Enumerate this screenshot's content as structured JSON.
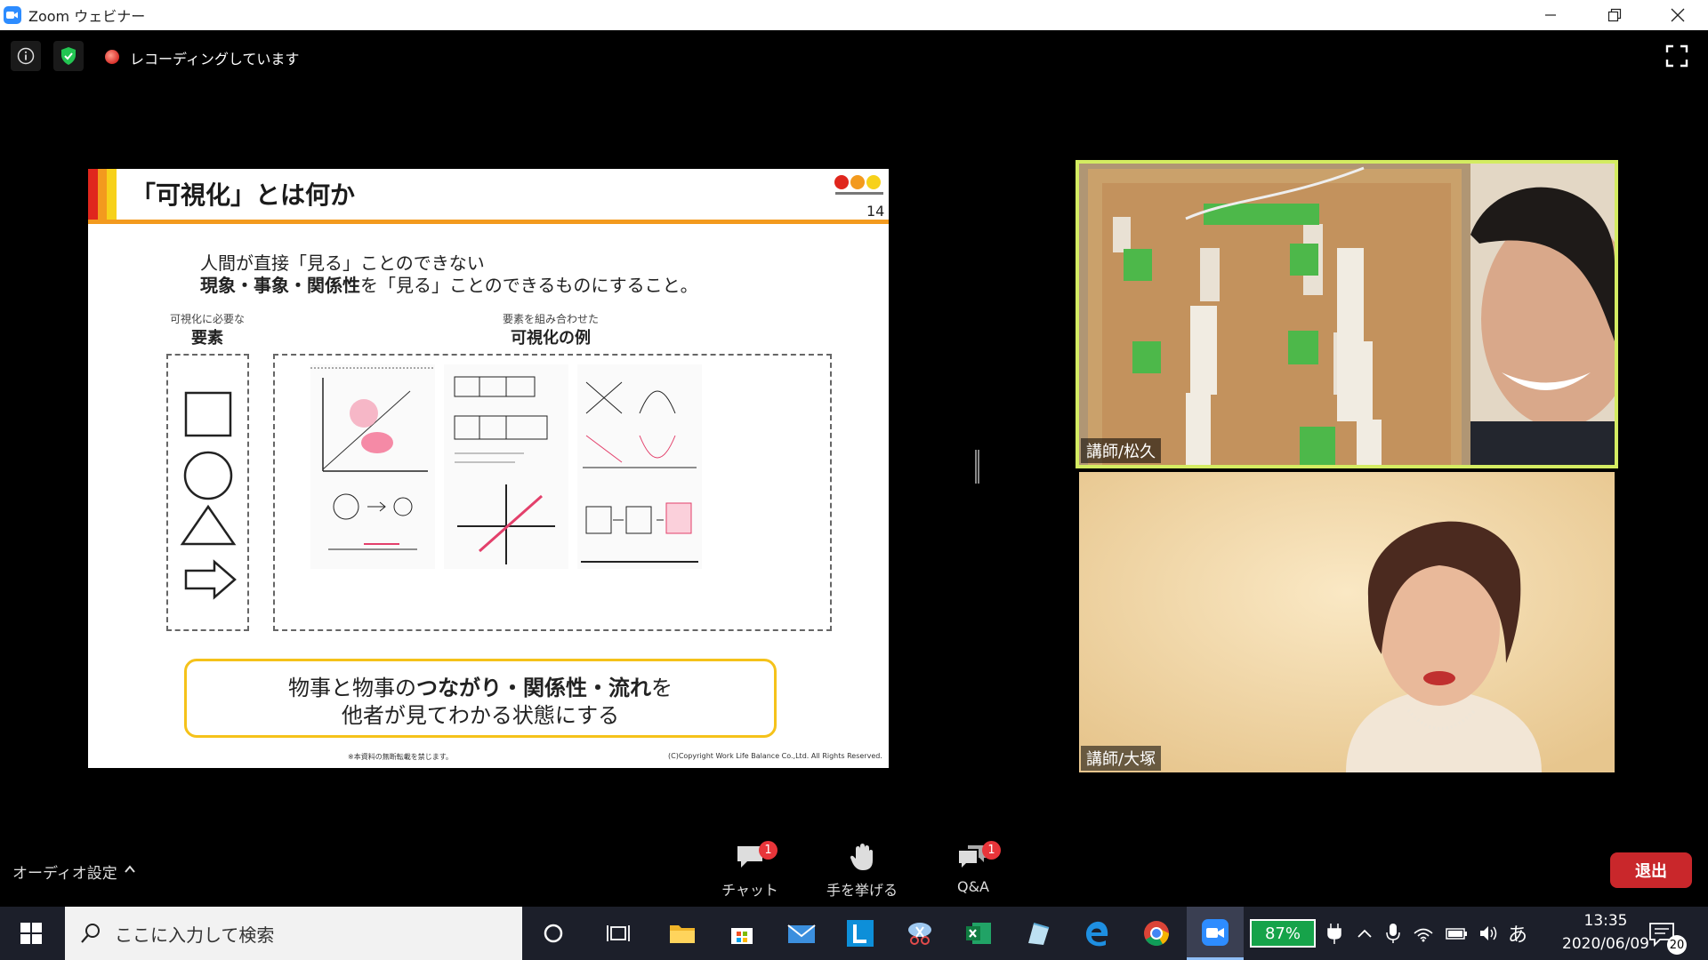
{
  "window": {
    "title": "Zoom ウェビナー"
  },
  "topbar": {
    "recording_text": "レコーディングしています"
  },
  "slide": {
    "title": "「可視化」とは何か",
    "page_number": "14",
    "intro_line1": "人間が直接「見る」ことのできない",
    "intro_line2_bold": "現象・事象・関係性",
    "intro_line2_rest": "を「見る」ことのできるものにすること。",
    "elements_small": "可視化に必要な",
    "elements_title": "要素",
    "examples_small": "要素を組み合わせた",
    "examples_title": "可視化の例",
    "message_line1_pre": "物事と物事の",
    "message_line1_bold": "つながり・関係性・流れ",
    "message_line1_post": "を",
    "message_line2": "他者が見てわかる状態にする",
    "footer_note": "※本資料の無断転載を禁じます。",
    "footer_copyright": "(C)Copyright Work Life Balance Co.,Ltd. All Rights Reserved."
  },
  "participants": [
    {
      "name": "講師/松久",
      "active_speaker": true
    },
    {
      "name": "講師/大塚",
      "active_speaker": false
    }
  ],
  "controls": {
    "audio_settings": "オーディオ設定",
    "chat": {
      "label": "チャット",
      "badge": "1"
    },
    "raise_hand": {
      "label": "手を挙げる"
    },
    "qa": {
      "label": "Q&A",
      "badge": "1"
    },
    "leave": "退出"
  },
  "taskbar": {
    "search_placeholder": "ここに入力して検索",
    "battery": "87%",
    "ime": "あ",
    "time": "13:35",
    "date": "2020/06/09",
    "notifications": "20"
  },
  "colors": {
    "accent_speaker": "#d4ec62",
    "leave_button": "#c9272b",
    "badge": "#e8353a"
  }
}
